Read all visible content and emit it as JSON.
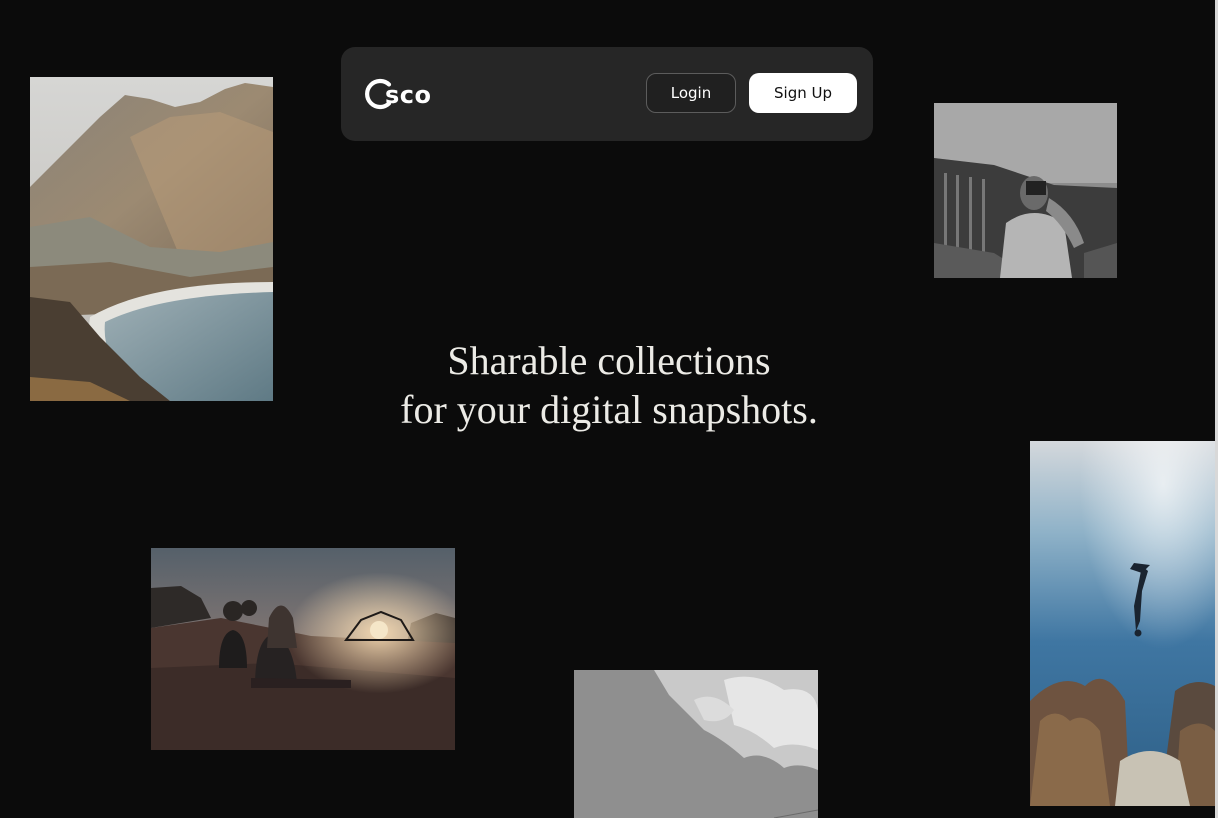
{
  "brand": {
    "name": "sco",
    "logo_icon": "c-ring-logo-icon",
    "accent": "#ffffff"
  },
  "nav": {
    "login_label": "Login",
    "signup_label": "Sign Up"
  },
  "hero": {
    "line1": "Sharable collections",
    "line2": "for your digital snapshots."
  },
  "colors": {
    "background": "#0b0b0b",
    "navbar": "#262626",
    "button_primary": "#ffffff",
    "headline": "#ecebe6"
  }
}
